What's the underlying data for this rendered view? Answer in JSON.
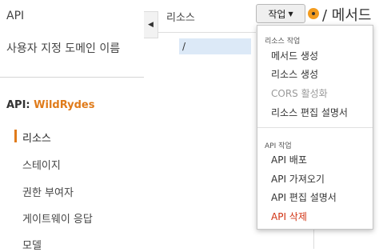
{
  "sidebar": {
    "top_link": "API",
    "custom_domains": "사용자 지정 도메인 이름",
    "api_prefix": "API:",
    "api_name": "WildRydes",
    "items": [
      {
        "label": "리소스",
        "active": true
      },
      {
        "label": "스테이지",
        "active": false
      },
      {
        "label": "권한 부여자",
        "active": false
      },
      {
        "label": "게이트웨이 응답",
        "active": false
      },
      {
        "label": "모델",
        "active": false
      }
    ]
  },
  "resources": {
    "title": "리소스",
    "root_path": "/"
  },
  "toolbar": {
    "actions_label": "작업",
    "method_title": "/ 메서드"
  },
  "dropdown": {
    "resource_section": "리소스 작업",
    "resource_items": [
      {
        "label": "메서드 생성",
        "state": "normal"
      },
      {
        "label": "리소스 생성",
        "state": "normal"
      },
      {
        "label": "CORS 활성화",
        "state": "disabled"
      },
      {
        "label": "리소스 편집 설명서",
        "state": "normal"
      }
    ],
    "api_section": "API 작업",
    "api_items": [
      {
        "label": "API 배포",
        "state": "normal"
      },
      {
        "label": "API 가져오기",
        "state": "normal"
      },
      {
        "label": "API 편집 설명서",
        "state": "normal"
      },
      {
        "label": "API 삭제",
        "state": "danger"
      }
    ]
  },
  "colors": {
    "accent": "#e07b1a",
    "danger": "#d13212",
    "selection": "#dce9f7"
  }
}
